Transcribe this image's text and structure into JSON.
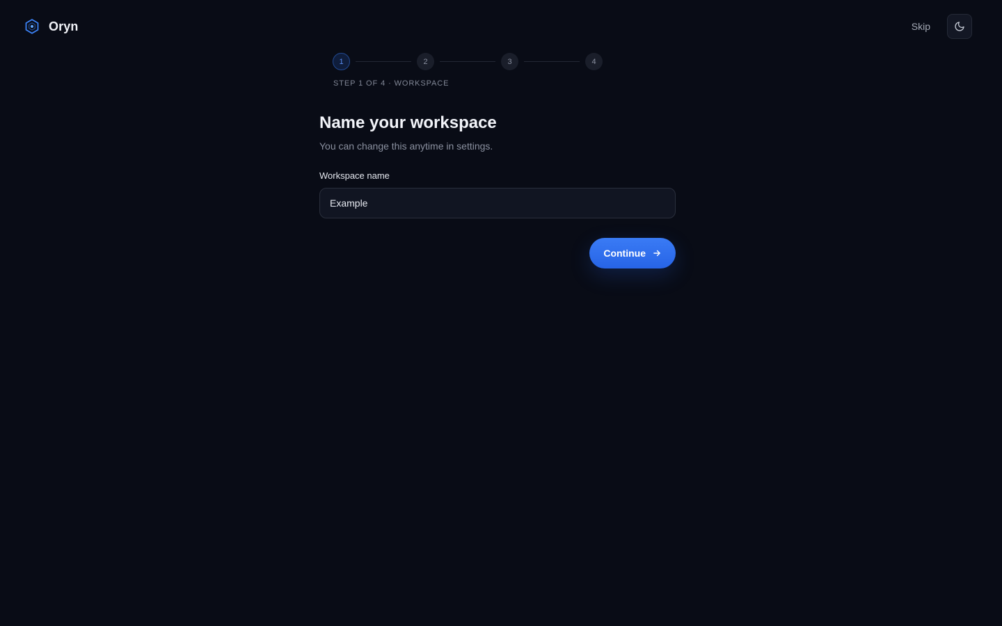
{
  "brand": {
    "name": "Oryn",
    "icon": "hexagon-logo-icon",
    "accent": "#3b82f6"
  },
  "header": {
    "skip_label": "Skip",
    "theme_toggle_icon": "moon-icon"
  },
  "stepper": {
    "steps": [
      "1",
      "2",
      "3",
      "4"
    ],
    "current_step": 1,
    "caption": "STEP 1 OF 4 · WORKSPACE"
  },
  "main": {
    "title": "Name your workspace",
    "subtitle": "You can change this anytime in settings.",
    "field": {
      "label": "Workspace name",
      "value": "Example"
    },
    "continue_label": "Continue",
    "continue_icon": "arrow-right-icon"
  },
  "colors": {
    "background": "#090c16",
    "primary_button": "#2f6ff0"
  }
}
